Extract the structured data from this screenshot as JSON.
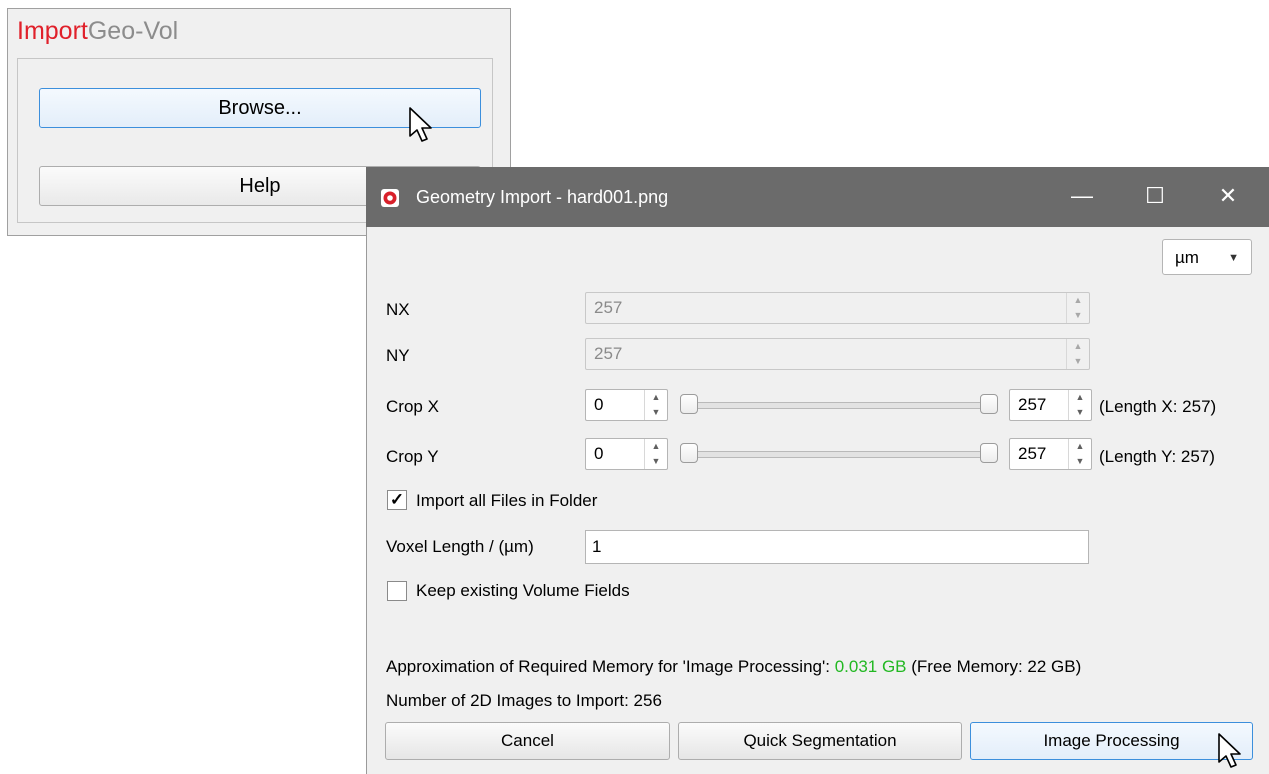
{
  "panel": {
    "title_part1": "Import",
    "title_part2": "Geo-Vol",
    "browse_label": "Browse...",
    "help_label": "Help"
  },
  "dialog": {
    "title": "Geometry Import - hard001.png",
    "minimize": "—",
    "maximize": "☐",
    "close": "✕",
    "unit": "µm",
    "nx_label": "NX",
    "nx_value": "257",
    "ny_label": "NY",
    "ny_value": "257",
    "crop_x_label": "Crop X",
    "crop_x_min": "0",
    "crop_x_max": "257",
    "crop_x_length": "(Length X: 257)",
    "crop_y_label": "Crop Y",
    "crop_y_min": "0",
    "crop_y_max": "257",
    "crop_y_length": "(Length Y: 257)",
    "import_all_label": "Import all Files in Folder",
    "import_all_checked": true,
    "voxel_label": "Voxel Length / (µm)",
    "voxel_value": "1",
    "keep_fields_label": "Keep existing Volume Fields",
    "keep_fields_checked": false,
    "memory_prefix": "Approximation of Required Memory for 'Image Processing': ",
    "memory_value": "0.031 GB",
    "memory_suffix": " (Free Memory: 22 GB)",
    "images_label": "Number of 2D Images to Import: 256",
    "cancel_label": "Cancel",
    "quick_seg_label": "Quick Segmentation",
    "image_proc_label": "Image Processing"
  },
  "colors": {
    "title_red": "#e0202a",
    "title_gray": "#8c8c8c",
    "titlebar": "#6b6b6b",
    "memory_green": "#22b822",
    "focus_blue": "#3c8fdc"
  },
  "icons": [
    "app-icon",
    "minimize-icon",
    "maximize-icon",
    "close-icon",
    "chevron-down-icon",
    "checkmark-icon",
    "mouse-cursor-icon"
  ]
}
